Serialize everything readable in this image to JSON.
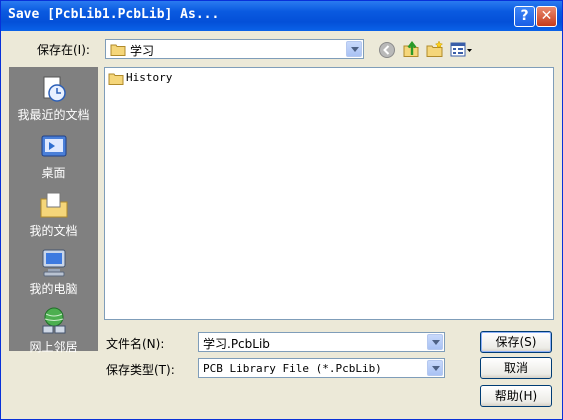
{
  "window": {
    "title": "Save [PcbLib1.PcbLib] As...",
    "help_glyph": "?",
    "close_glyph": "✕"
  },
  "lookin": {
    "label": "保存在(I):",
    "value": "学习"
  },
  "places": [
    {
      "label": "我最近的文档",
      "icon": "recent-documents-icon"
    },
    {
      "label": "桌面",
      "icon": "desktop-icon"
    },
    {
      "label": "我的文档",
      "icon": "my-documents-icon"
    },
    {
      "label": "我的电脑",
      "icon": "my-computer-icon"
    },
    {
      "label": "网上邻居",
      "icon": "network-places-icon"
    }
  ],
  "files": [
    {
      "name": "History",
      "icon": "folder-icon"
    }
  ],
  "filename": {
    "label": "文件名(N):",
    "value": "学习.PcbLib"
  },
  "filetype": {
    "label": "保存类型(T):",
    "value": "PCB Library File (*.PcbLib)"
  },
  "buttons": {
    "save": "保存(S)",
    "cancel": "取消",
    "help": "帮助(H)"
  },
  "colors": {
    "titlebar": "#0a5ae0",
    "dialog_bg": "#ece9d8",
    "places_bg": "#808080"
  }
}
